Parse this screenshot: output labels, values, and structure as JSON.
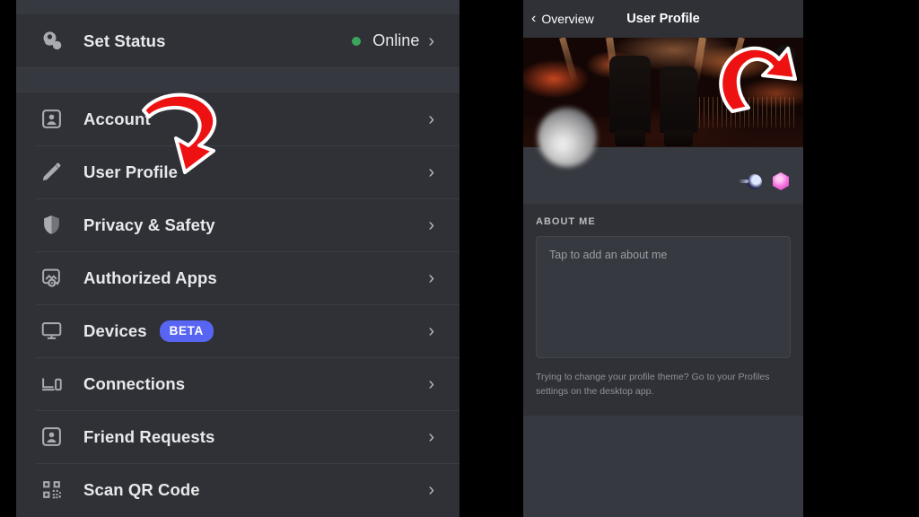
{
  "settings_panel": {
    "status_row": {
      "icon": "set-status-icon",
      "label": "Set Status",
      "value": "Online",
      "dot_color": "#3ba55c",
      "chevron": "›"
    },
    "items": [
      {
        "icon": "account-icon",
        "label": "Account",
        "chevron": "›",
        "badge": null
      },
      {
        "icon": "pencil-icon",
        "label": "User Profile",
        "chevron": "›",
        "badge": null
      },
      {
        "icon": "shield-icon",
        "label": "Privacy & Safety",
        "chevron": "›",
        "badge": null
      },
      {
        "icon": "authorized-apps-icon",
        "label": "Authorized Apps",
        "chevron": "›",
        "badge": null
      },
      {
        "icon": "monitor-icon",
        "label": "Devices",
        "chevron": "›",
        "badge": "BETA"
      },
      {
        "icon": "connections-icon",
        "label": "Connections",
        "chevron": "›",
        "badge": null
      },
      {
        "icon": "friend-requests-icon",
        "label": "Friend Requests",
        "chevron": "›",
        "badge": null
      },
      {
        "icon": "qr-code-icon",
        "label": "Scan QR Code",
        "chevron": "›",
        "badge": null
      }
    ]
  },
  "profile_panel": {
    "header": {
      "back_label": "Overview",
      "back_chevron": "‹",
      "title": "User Profile"
    },
    "banner": {
      "edit_icon": "pencil-icon",
      "badges": [
        "comet-badge",
        "hexagon-badge"
      ]
    },
    "about": {
      "heading": "ABOUT ME",
      "placeholder": "Tap to add an about me",
      "note": "Trying to change your profile theme? Go to your Profiles settings on the desktop app."
    }
  },
  "annotations": {
    "arrow_color": "#ee1111",
    "arrow_outline": "#ffffff",
    "arrows": [
      {
        "name": "arrow-pointing-to-user-profile"
      },
      {
        "name": "arrow-pointing-to-banner-edit"
      }
    ]
  },
  "theme": {
    "panel_bg": "#2f3136",
    "panel_alt_bg": "#36393f",
    "accent_blurple": "#5865f2",
    "text_primary": "#e8e9eb",
    "text_muted": "#8e9297"
  }
}
